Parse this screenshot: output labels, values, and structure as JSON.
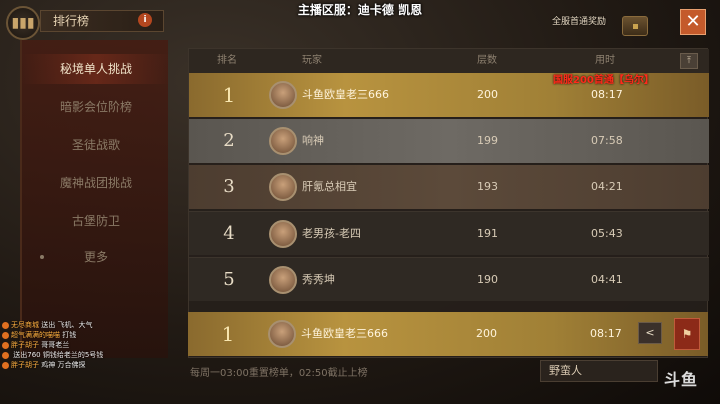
{
  "streamer_banner": "主播区服：迪卡德 凯恩",
  "header": {
    "title": "排行榜",
    "info_icon": "i",
    "reward_label": "全服首通奖励",
    "close_label": "✕"
  },
  "menu": {
    "items": [
      {
        "label": "秘境单人挑战",
        "active": true
      },
      {
        "label": "暗影会位阶榜",
        "active": false
      },
      {
        "label": "圣徒战歌",
        "active": false
      },
      {
        "label": "魔神战团挑战",
        "active": false
      },
      {
        "label": "古堡防卫",
        "active": false
      },
      {
        "label": "更多",
        "active": false
      }
    ]
  },
  "table": {
    "columns": [
      "排名",
      "玩家",
      "层数",
      "用时"
    ],
    "sort_icon": "⤒",
    "annotation": "国服200首通【乌尔】",
    "rows": [
      {
        "rank": "1",
        "name": "斗鱼欧皇老三666",
        "floor": "200",
        "time": "08:17",
        "style": "gold"
      },
      {
        "rank": "2",
        "name": "响神",
        "floor": "199",
        "time": "07:58",
        "style": "silver"
      },
      {
        "rank": "3",
        "name": "肝氪总相宜",
        "floor": "193",
        "time": "04:21",
        "style": "bronze"
      },
      {
        "rank": "4",
        "name": "老男孩-老四",
        "floor": "191",
        "time": "05:43",
        "style": "plain"
      },
      {
        "rank": "5",
        "name": "秀秀坤",
        "floor": "190",
        "time": "04:41",
        "style": "plain"
      }
    ],
    "my_row": {
      "rank": "1",
      "name": "斗鱼欧皇老三666",
      "floor": "200",
      "time": "08:17",
      "share_icon": "<",
      "badge_icon": "⚑"
    }
  },
  "footer": {
    "note": "每周一03:00重置榜单，02:50截止上榜",
    "guild": "野蛮人",
    "logo": "斗鱼"
  },
  "chat": [
    {
      "user": "无尽商城",
      "text": "送出 飞机、大气"
    },
    {
      "user": "超气满满的喵喵",
      "text": "打钱"
    },
    {
      "user": "胖子胡子",
      "text": "哥哥老兰"
    },
    {
      "user": "",
      "text": "送出760 铜钱给老兰的5号钱"
    },
    {
      "user": "胖子胡子",
      "text": "鸡神 万合佛探"
    }
  ]
}
